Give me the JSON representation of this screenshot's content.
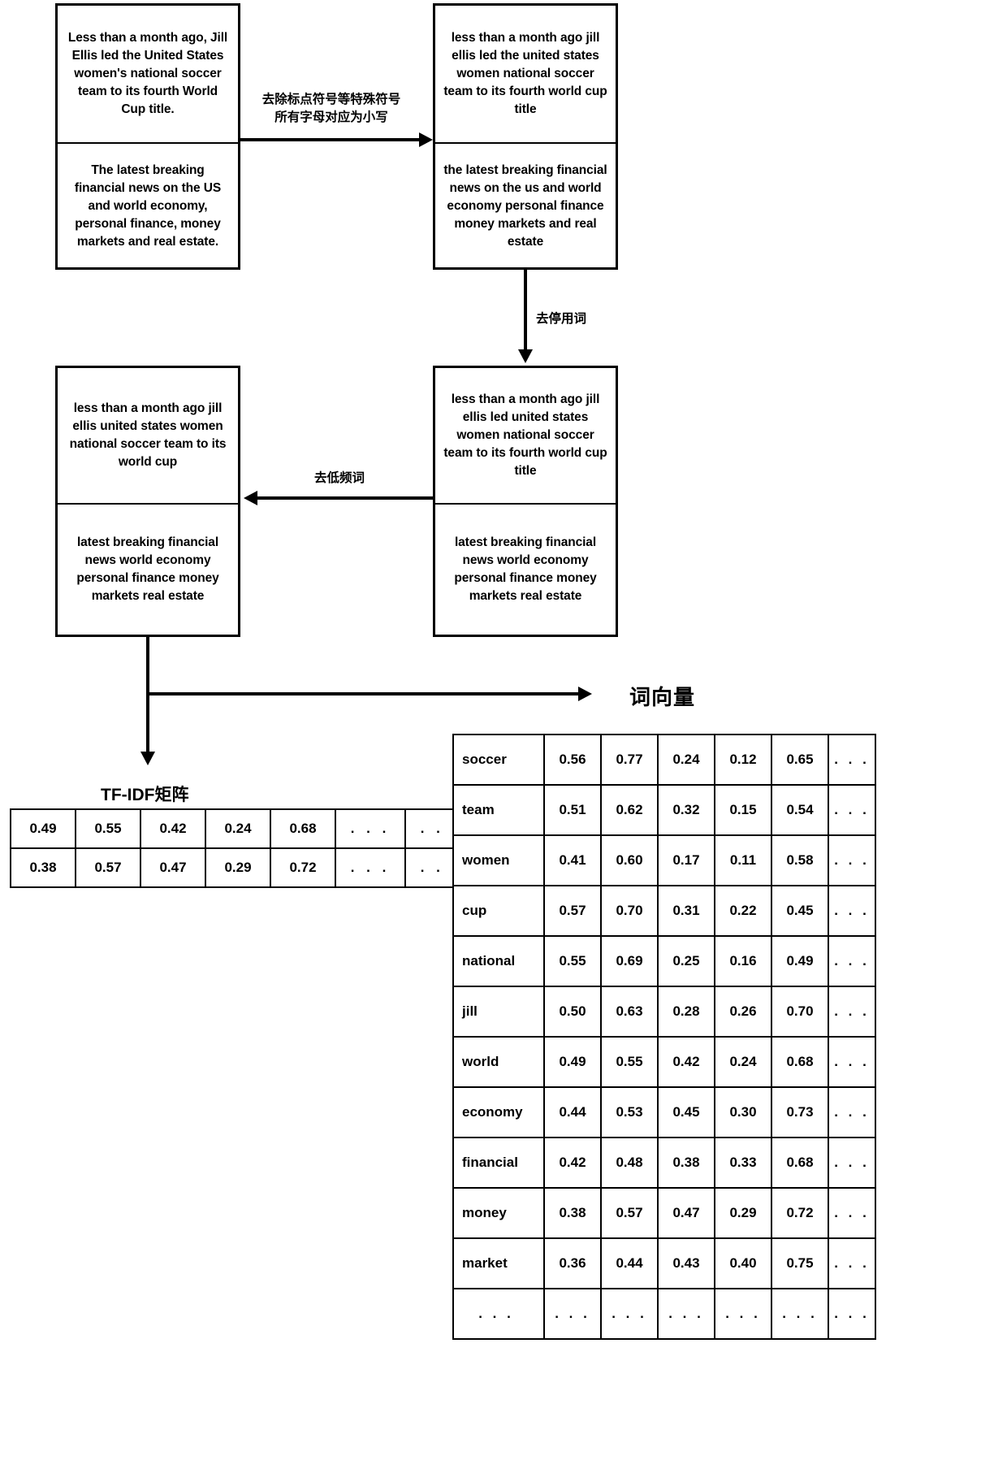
{
  "diagram": {
    "title_wordvec": "词向量",
    "title_tfidf": "TF-IDF矩阵"
  },
  "boxes": {
    "original": {
      "doc1": "Less than a month ago, Jill Ellis led the United States women's national soccer team to its fourth World Cup title.",
      "doc2": "The latest breaking financial news on the US and world economy, personal finance, money markets and real estate."
    },
    "normalized": {
      "doc1": "less than a month ago jill ellis led the united states women national soccer team to its fourth world cup title",
      "doc2": "the latest breaking financial news on the us and world economy personal finance money markets and real estate"
    },
    "stopwords_removed": {
      "doc1": "less than a month ago jill ellis led united states women national soccer team to its fourth world cup title",
      "doc2": "latest breaking financial news world economy personal finance money markets real estate"
    },
    "lowfreq_removed": {
      "doc1": "less than a month ago jill ellis united states women national soccer team to its world cup",
      "doc2": "latest breaking financial news world economy personal finance money markets real estate"
    }
  },
  "arrows": {
    "normalize": "去除标点符号等特殊符号\n所有字母对应为小写",
    "remove_stopwords": "去停用词",
    "remove_lowfreq": "去低频词"
  },
  "tfidf_matrix": {
    "rows": [
      [
        "0.49",
        "0.55",
        "0.42",
        "0.24",
        "0.68",
        ". . .",
        ". . ."
      ],
      [
        "0.38",
        "0.57",
        "0.47",
        "0.29",
        "0.72",
        ". . .",
        ". . ."
      ]
    ]
  },
  "chart_data": {
    "type": "table",
    "title": "词向量",
    "terms": [
      "soccer",
      "team",
      "women",
      "cup",
      "national",
      "jill",
      "world",
      "economy",
      "financial",
      "money",
      "market",
      ". . ."
    ],
    "rows": [
      {
        "term": "soccer",
        "values": [
          "0.56",
          "0.77",
          "0.24",
          "0.12",
          "0.65"
        ],
        "more": ". . ."
      },
      {
        "term": "team",
        "values": [
          "0.51",
          "0.62",
          "0.32",
          "0.15",
          "0.54"
        ],
        "more": ". . ."
      },
      {
        "term": "women",
        "values": [
          "0.41",
          "0.60",
          "0.17",
          "0.11",
          "0.58"
        ],
        "more": ". . ."
      },
      {
        "term": "cup",
        "values": [
          "0.57",
          "0.70",
          "0.31",
          "0.22",
          "0.45"
        ],
        "more": ". . ."
      },
      {
        "term": "national",
        "values": [
          "0.55",
          "0.69",
          "0.25",
          "0.16",
          "0.49"
        ],
        "more": ". . ."
      },
      {
        "term": "jill",
        "values": [
          "0.50",
          "0.63",
          "0.28",
          "0.26",
          "0.70"
        ],
        "more": ". . ."
      },
      {
        "term": "world",
        "values": [
          "0.49",
          "0.55",
          "0.42",
          "0.24",
          "0.68"
        ],
        "more": ". . ."
      },
      {
        "term": "economy",
        "values": [
          "0.44",
          "0.53",
          "0.45",
          "0.30",
          "0.73"
        ],
        "more": ". . ."
      },
      {
        "term": "financial",
        "values": [
          "0.42",
          "0.48",
          "0.38",
          "0.33",
          "0.68"
        ],
        "more": ". . ."
      },
      {
        "term": "money",
        "values": [
          "0.38",
          "0.57",
          "0.47",
          "0.29",
          "0.72"
        ],
        "more": ". . ."
      },
      {
        "term": "market",
        "values": [
          "0.36",
          "0.44",
          "0.43",
          "0.40",
          "0.75"
        ],
        "more": ". . ."
      },
      {
        "term": ". . .",
        "values": [
          ". . .",
          ". . .",
          ". . .",
          ". . .",
          ". . ."
        ],
        "more": ". . ."
      }
    ]
  }
}
